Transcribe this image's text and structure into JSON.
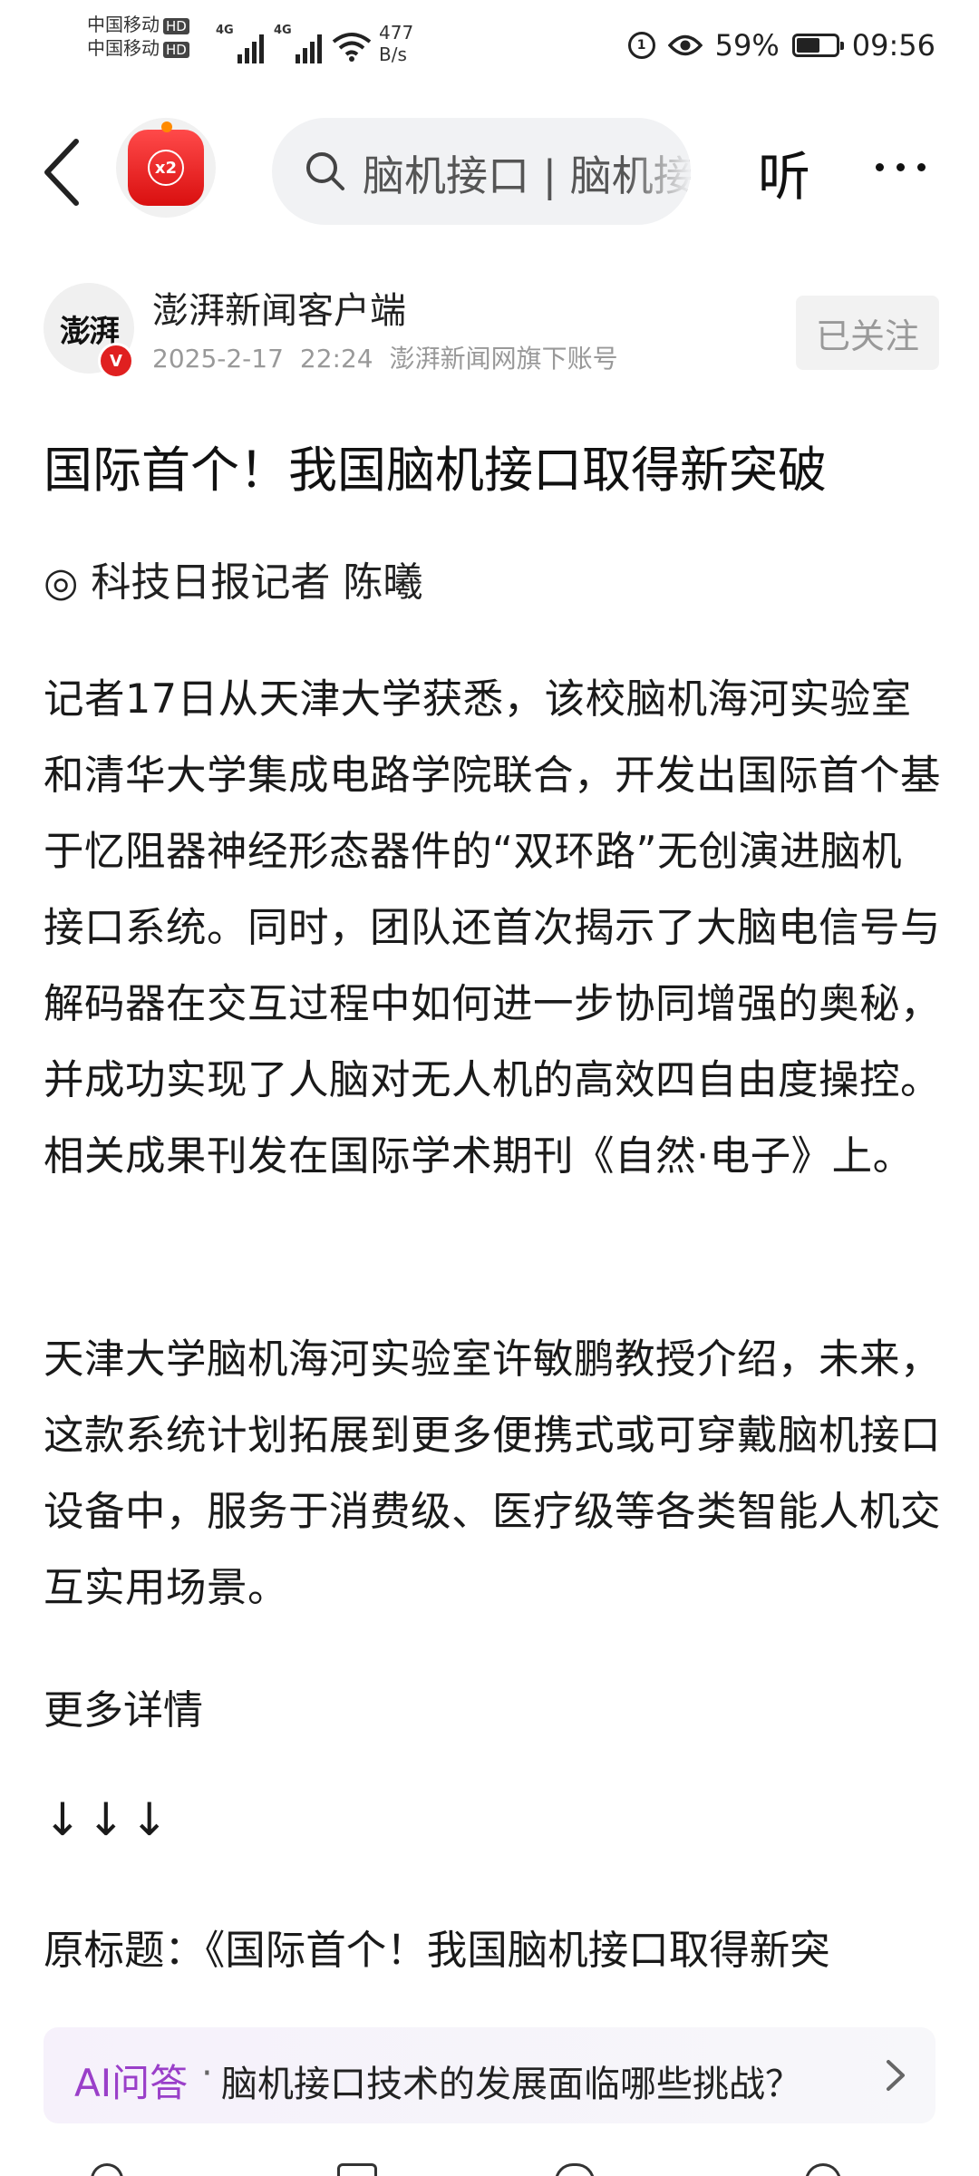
{
  "status_bar": {
    "carrier1": "中国移动",
    "carrier2": "中国移动",
    "hd": "HD",
    "net1": "4G",
    "net2": "4G",
    "speed_value": "477",
    "speed_unit": "B/s",
    "ring_glyph": "1",
    "battery_percent": 59,
    "battery_text": "59%",
    "time": "09:56",
    "icons": [
      "signal-icon",
      "wifi-icon",
      "eye-icon",
      "battery-icon"
    ]
  },
  "nav": {
    "back_icon": "chevron-left-icon",
    "avatar_badge": "x2",
    "search_text": "脑机接口 | 脑机接",
    "listen_label": "听",
    "more_icon": "more-dots-icon"
  },
  "publisher": {
    "logo_text": "澎湃",
    "verified_mark": "V",
    "name": "澎湃新闻客户端",
    "date": "2025-2-17",
    "time": "22:24",
    "account_desc": "澎湃新闻网旗下账号",
    "follow_label": "已关注"
  },
  "article": {
    "title": "国际首个！我国脑机接口取得新突破",
    "byline": "◎ 科技日报记者 陈曦",
    "paragraph1": "记者17日从天津大学获悉，该校脑机海河实验室和清华大学集成电路学院联合，开发出国际首个基于忆阻器神经形态器件的“双环路”无创演进脑机接口系统。同时，团队还首次揭示了大脑电信号与解码器在交互过程中如何进一步协同增强的奥秘，并成功实现了人脑对无人机的高效四自由度操控。相关成果刊发在国际学术期刊《自然·电子》上。",
    "paragraph2": "天津大学脑机海河实验室许敏鹏教授介绍，未来，这款系统计划拓展到更多便携式或可穿戴脑机接口设备中，服务于消费级、医疗级等各类智能人机交互实用场景。",
    "more_details": "更多详情",
    "arrows": "↓↓↓",
    "original_title": "原标题：《国际首个！我国脑机接口取得新突"
  },
  "ai_bar": {
    "label": "AI问答",
    "dot": "·",
    "question": "脑机接口技术的发展面临哪些挑战？",
    "chevron_icon": "chevron-right-icon"
  },
  "colors": {
    "ai_accent": "#9a3fc9",
    "badge_red": "#e02020",
    "search_bg": "#f1f2f4"
  }
}
